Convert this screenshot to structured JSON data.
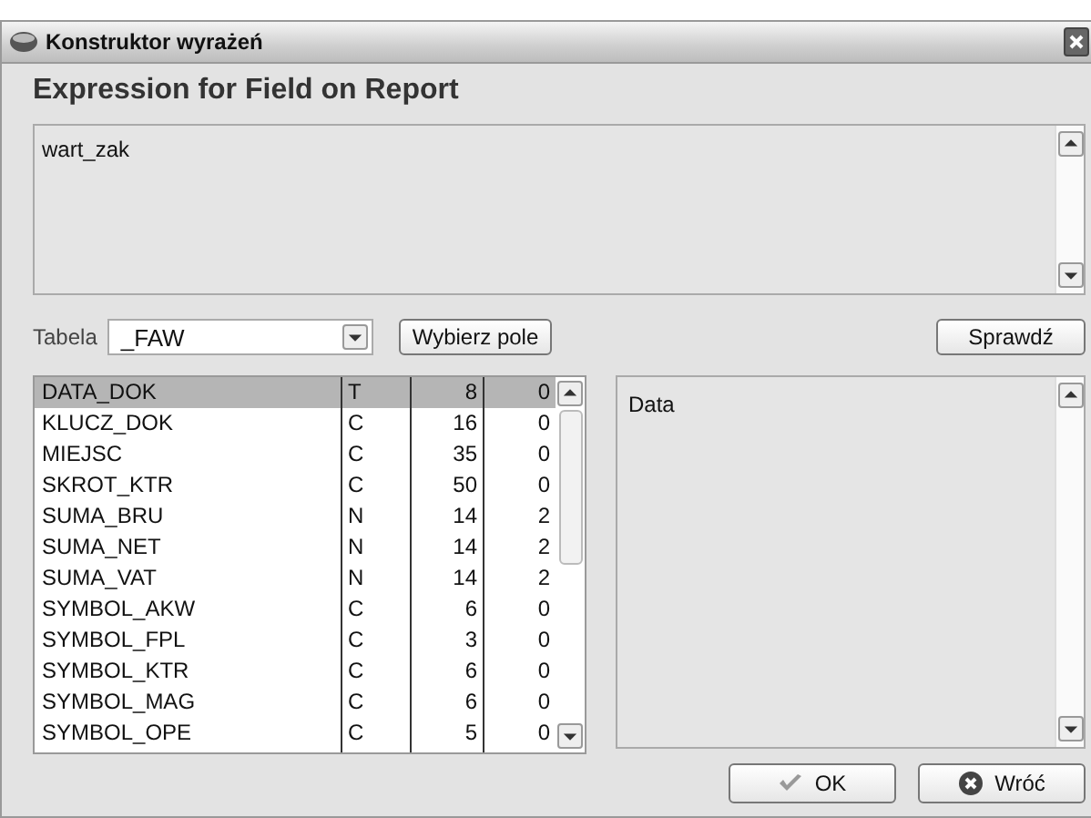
{
  "window": {
    "title": "Konstruktor wyrażeń"
  },
  "heading": "Expression for Field on Report",
  "expression": {
    "value": "wart_zak"
  },
  "table_picker": {
    "label": "Tabela",
    "value": "_FAW"
  },
  "pick_field_button": "Wybierz pole",
  "check_button": "Sprawdź",
  "fields": [
    {
      "name": "DATA_DOK",
      "type": "T",
      "length": "8",
      "decimals": "0",
      "selected": true
    },
    {
      "name": "KLUCZ_DOK",
      "type": "C",
      "length": "16",
      "decimals": "0",
      "selected": false
    },
    {
      "name": "MIEJSC",
      "type": "C",
      "length": "35",
      "decimals": "0",
      "selected": false
    },
    {
      "name": "SKROT_KTR",
      "type": "C",
      "length": "50",
      "decimals": "0",
      "selected": false
    },
    {
      "name": "SUMA_BRU",
      "type": "N",
      "length": "14",
      "decimals": "2",
      "selected": false
    },
    {
      "name": "SUMA_NET",
      "type": "N",
      "length": "14",
      "decimals": "2",
      "selected": false
    },
    {
      "name": "SUMA_VAT",
      "type": "N",
      "length": "14",
      "decimals": "2",
      "selected": false
    },
    {
      "name": "SYMBOL_AKW",
      "type": "C",
      "length": "6",
      "decimals": "0",
      "selected": false
    },
    {
      "name": "SYMBOL_FPL",
      "type": "C",
      "length": "3",
      "decimals": "0",
      "selected": false
    },
    {
      "name": "SYMBOL_KTR",
      "type": "C",
      "length": "6",
      "decimals": "0",
      "selected": false
    },
    {
      "name": "SYMBOL_MAG",
      "type": "C",
      "length": "6",
      "decimals": "0",
      "selected": false
    },
    {
      "name": "SYMBOL_OPE",
      "type": "C",
      "length": "5",
      "decimals": "0",
      "selected": false
    }
  ],
  "description": "Data",
  "buttons": [
    {
      "label": "OK",
      "kind": "ok"
    },
    {
      "label": "Wróć",
      "kind": "back"
    }
  ]
}
